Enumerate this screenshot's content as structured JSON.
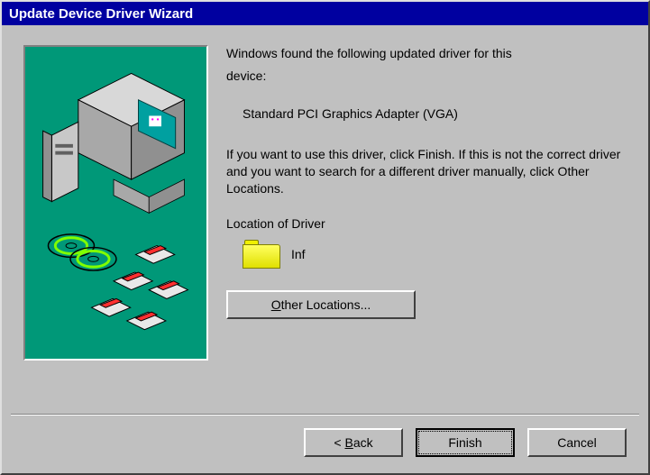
{
  "titlebar": "Update Device Driver Wizard",
  "intro_line1": "Windows found the following updated driver for this",
  "intro_line2": "device:",
  "device_name": "Standard PCI Graphics Adapter (VGA)",
  "instructions": "If you want to use this driver, click Finish. If this is not the correct driver and you want to search for a different driver manually, click Other Locations.",
  "location_label": "Location of Driver",
  "location_value": "Inf",
  "buttons": {
    "other": "Other Locations...",
    "back": "Back",
    "back_mnemonic": "B",
    "finish": "Finish",
    "cancel": "Cancel",
    "other_mnemonic": "O"
  }
}
